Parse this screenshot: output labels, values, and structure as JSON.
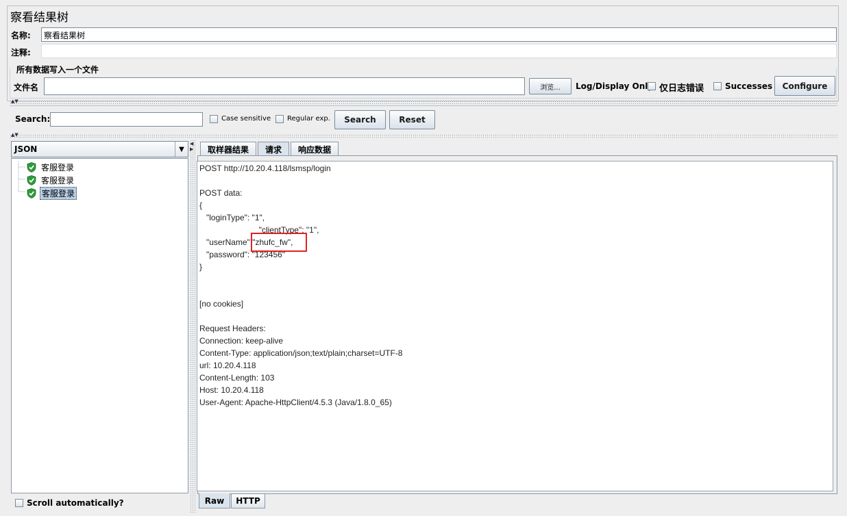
{
  "header": {
    "title": "察看结果树",
    "name_label": "名称:",
    "name_value": "察看结果树",
    "comment_label": "注释:",
    "comment_value": ""
  },
  "file_section": {
    "group_title": "所有数据写入一个文件",
    "file_label": "文件名",
    "file_value": "",
    "browse_label": "浏览...",
    "log_display_label": "Log/Display Only:",
    "errors_only_label": "仅日志错误",
    "successes_label": "Successes",
    "configure_label": "Configure"
  },
  "search": {
    "label": "Search:",
    "value": "",
    "case_sensitive_label": "Case sensitive",
    "regex_label": "Regular exp.",
    "search_button": "Search",
    "reset_button": "Reset"
  },
  "left_panel": {
    "renderer_selected": "JSON",
    "tree_items": [
      {
        "label": "客服登录",
        "selected": false
      },
      {
        "label": "客服登录",
        "selected": false
      },
      {
        "label": "客服登录",
        "selected": true
      }
    ],
    "scroll_auto_label": "Scroll automatically?"
  },
  "right_panel": {
    "tabs": [
      {
        "label": "取样器结果",
        "active": false
      },
      {
        "label": "请求",
        "active": true
      },
      {
        "label": "响应数据",
        "active": false
      }
    ],
    "request_lines": [
      "POST http://10.20.4.118/lsmsp/login",
      "",
      "POST data:",
      "{",
      "   \"loginType\": \"1\",",
      "                          \"clientType\": \"1\",",
      "   \"userName\":\"zhufc_fw\",",
      "   \"password\": \"123456\"",
      "}",
      "",
      "",
      "[no cookies]",
      "",
      "Request Headers:",
      "Connection: keep-alive",
      "Content-Type: application/json;text/plain;charset=UTF-8",
      "url: 10.20.4.118",
      "Content-Length: 103",
      "Host: 10.20.4.118",
      "User-Agent: Apache-HttpClient/4.5.3 (Java/1.8.0_65)"
    ],
    "bottom_tabs": [
      {
        "label": "Raw",
        "active": true
      },
      {
        "label": "HTTP",
        "active": false
      }
    ]
  },
  "colors": {
    "highlight_box": "#e02020",
    "shield_green": "#2e9c3a",
    "selection": "#b8cfe5"
  }
}
